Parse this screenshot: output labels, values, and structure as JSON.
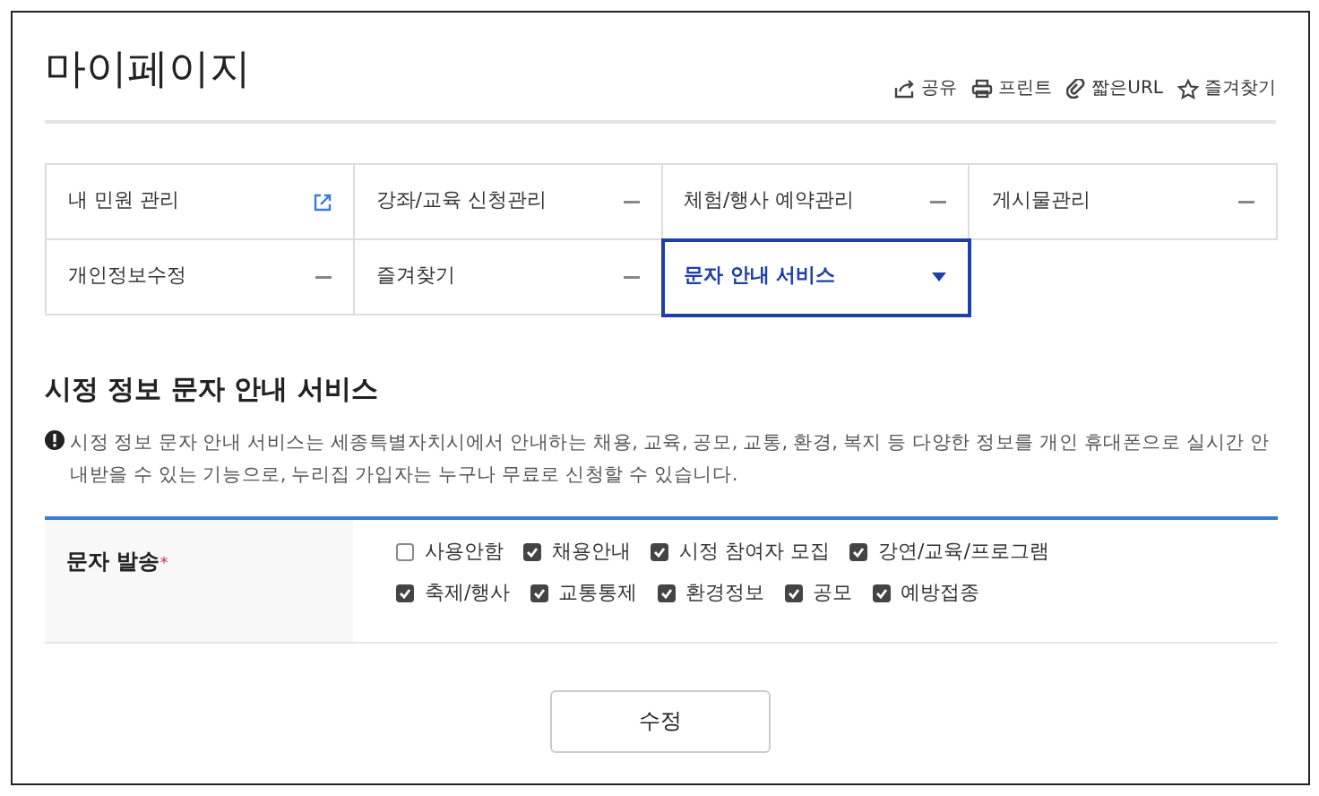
{
  "page_title": "마이페이지",
  "tools": [
    {
      "kind": "share",
      "label": "공유"
    },
    {
      "kind": "print",
      "label": "프린트"
    },
    {
      "kind": "link",
      "label": "짧은URL"
    },
    {
      "kind": "star",
      "label": "즐겨찾기"
    }
  ],
  "menu": [
    {
      "label": "내 민원 관리",
      "kind": "external",
      "selected": false
    },
    {
      "label": "강좌/교육 신청관리",
      "kind": "collapsed",
      "selected": false
    },
    {
      "label": "체험/행사 예약관리",
      "kind": "collapsed",
      "selected": false
    },
    {
      "label": "게시물관리",
      "kind": "collapsed",
      "selected": false
    },
    {
      "label": "개인정보수정",
      "kind": "collapsed",
      "selected": false
    },
    {
      "label": "즐겨찾기",
      "kind": "collapsed",
      "selected": false
    },
    {
      "label": "문자 안내 서비스",
      "kind": "dropdown",
      "selected": true
    }
  ],
  "section_title": "시정 정보 문자 안내 서비스",
  "notice": "시정 정보 문자 안내 서비스는 세종특별자치시에서 안내하는 채용, 교육, 공모, 교통, 환경, 복지 등 다양한 정보를 개인 휴대폰으로 실시간 안내받을 수 있는 기능으로, 누리집 가입자는 누구나 무료로 신청할 수 있습니다.",
  "form": {
    "label": "문자 발송",
    "required_mark": "*",
    "options": [
      [
        {
          "label": "사용안함",
          "checked": false
        },
        {
          "label": "채용안내",
          "checked": true
        },
        {
          "label": "시정 참여자 모집",
          "checked": true
        },
        {
          "label": "강연/교육/프로그램",
          "checked": true
        }
      ],
      [
        {
          "label": "축제/행사",
          "checked": true
        },
        {
          "label": "교통통제",
          "checked": true
        },
        {
          "label": "환경정보",
          "checked": true
        },
        {
          "label": "공모",
          "checked": true
        },
        {
          "label": "예방접종",
          "checked": true
        }
      ]
    ]
  },
  "submit_button": "수정"
}
